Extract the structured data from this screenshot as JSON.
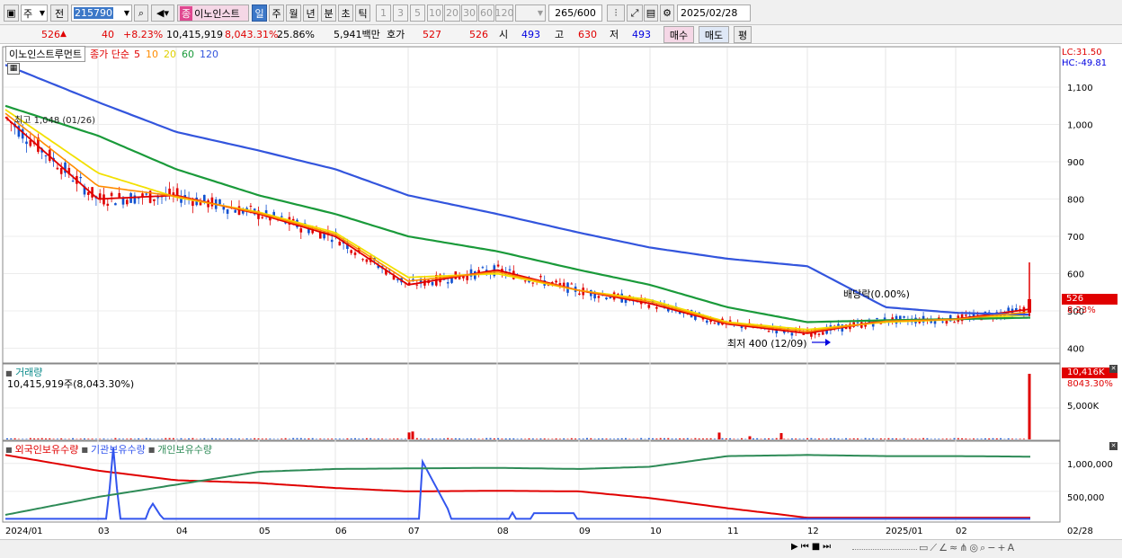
{
  "toolbar": {
    "market_select": "주",
    "prev_label": "전",
    "code_value": "215790",
    "stock_badge": "종",
    "stock_name": "이노인스트",
    "periods": [
      "일",
      "주",
      "월",
      "년",
      "분",
      "초",
      "틱"
    ],
    "numbers": [
      "1",
      "3",
      "5",
      "10",
      "20",
      "30",
      "60",
      "120"
    ],
    "count_value": "265",
    "count_total": "/600",
    "date_value": "2025/02/28"
  },
  "info": {
    "price": "526",
    "change": "40",
    "change_pct": "+8.23%",
    "volume": "10,415,919",
    "vol_ratio": "8,043.31%",
    "turnover": "25.86%",
    "amount": "5,941백만",
    "ask_label": "호가",
    "ask_value": "527",
    "bid_value": "526",
    "open_label": "시",
    "open_value": "493",
    "high_label": "고",
    "high_value": "630",
    "low_label": "저",
    "low_value": "493",
    "buy_label": "매수",
    "sell_label": "매도",
    "avg_label": "평"
  },
  "price_panel": {
    "title": "이노인스트루먼트",
    "ma_label": "종가 단순",
    "ma_periods": [
      "5",
      "10",
      "20",
      "60",
      "120"
    ],
    "ma_colors": [
      "#e00000",
      "#ff8c00",
      "#f2e000",
      "#1a9a3a",
      "#3355dd"
    ],
    "lc": "LC:31.50",
    "hc": "HC:-49.81",
    "y_ticks": [
      "1,100",
      "1,000",
      "900",
      "800",
      "700",
      "600",
      "500",
      "400"
    ],
    "last_price_tag": "526",
    "last_change_tag": "8.23%",
    "max_label": "최고 1,048 (01/26)",
    "min_label": "최저 400 (12/09)",
    "dividend_label": "배당락(0.00%)"
  },
  "volume_panel": {
    "title": "거래량",
    "summary": "10,415,919주(8,043.30%)",
    "tag_value": "10,416K",
    "tag_pct": "8043.30%",
    "y_tick": "5,000K"
  },
  "holding_panel": {
    "series": [
      "외국인보유수량",
      "기관보유수량",
      "개인보유수량"
    ],
    "series_colors": [
      "#e00000",
      "#3355ee",
      "#2e8b57"
    ],
    "y_ticks": [
      "1,000,000",
      "500,000"
    ]
  },
  "x_axis": {
    "labels": [
      "2024/01",
      "03",
      "04",
      "05",
      "06",
      "07",
      "08",
      "09",
      "10",
      "11",
      "12",
      "2025/01",
      "02"
    ],
    "right_label": "02/28"
  },
  "chart_data": [
    {
      "type": "line",
      "title": "이노인스트루먼트",
      "ylim": [
        370,
        1170
      ],
      "x": [
        "2024/01",
        "03",
        "04",
        "05",
        "06",
        "07",
        "08",
        "09",
        "10",
        "11",
        "12",
        "2025/01",
        "02",
        "02/28"
      ],
      "series": [
        {
          "name": "5",
          "values": [
            1020,
            800,
            810,
            760,
            700,
            570,
            610,
            555,
            520,
            465,
            440,
            475,
            478,
            505
          ]
        },
        {
          "name": "20",
          "values": [
            1040,
            870,
            805,
            765,
            710,
            590,
            600,
            555,
            530,
            470,
            450,
            470,
            477,
            490
          ]
        },
        {
          "name": "60",
          "values": [
            1050,
            970,
            880,
            810,
            760,
            700,
            660,
            610,
            570,
            510,
            470,
            475,
            478,
            482
          ]
        },
        {
          "name": "120",
          "values": [
            1160,
            1060,
            980,
            930,
            880,
            810,
            760,
            710,
            670,
            640,
            620,
            510,
            495,
            490
          ]
        }
      ],
      "annotations": [
        "최고 1,048 (01/26)",
        "최저 400 (12/09)",
        "배당락(0.00%)"
      ]
    },
    {
      "type": "bar",
      "title": "거래량",
      "x": [
        "07",
        "10",
        "11",
        "02/28"
      ],
      "values": [
        1200,
        1080,
        1000,
        10416
      ],
      "ylabel": "K"
    },
    {
      "type": "line",
      "title": "보유수량",
      "x": [
        "2024/01",
        "03",
        "04",
        "05",
        "06",
        "07",
        "08",
        "09",
        "10",
        "11",
        "12",
        "2025/01",
        "02",
        "02/28"
      ],
      "ylim": [
        0,
        1300000
      ],
      "series": [
        {
          "name": "외국인보유수량",
          "values": [
            1150000,
            870000,
            700000,
            650000,
            560000,
            500000,
            510000,
            500000,
            380000,
            200000,
            30000,
            30000,
            30000,
            30000
          ]
        },
        {
          "name": "기관보유수량",
          "values": [
            10000,
            10000,
            10000,
            10000,
            10000,
            10000,
            10000,
            10000,
            10000,
            10000,
            5000,
            5000,
            5000,
            5000
          ]
        },
        {
          "name": "개인보유수량",
          "values": [
            80000,
            400000,
            620000,
            850000,
            900000,
            910000,
            920000,
            900000,
            940000,
            1130000,
            1150000,
            1130000,
            1130000,
            1120000
          ]
        }
      ]
    }
  ]
}
